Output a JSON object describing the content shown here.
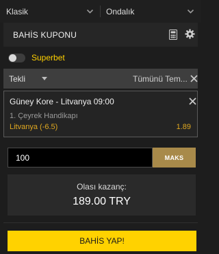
{
  "dropdowns": {
    "odds_format": "Klasik",
    "odds_display": "Ondalık"
  },
  "header": {
    "title": "BAHİS KUPONU",
    "icons": [
      "calculator-icon",
      "gear-icon"
    ]
  },
  "superbet": {
    "label": "Superbet",
    "enabled": false
  },
  "bet_type": {
    "selected": "Tekli",
    "remove_all": "Tümünü Tem..."
  },
  "bet": {
    "match": "Güney Kore - Litvanya 09:00",
    "market": "1. Çeyrek Handikapı",
    "selection": "Litvanya (-6.5)",
    "odds": "1.89"
  },
  "stake": {
    "value": "100",
    "max_label": "MAKS"
  },
  "winnings": {
    "label": "Olası kazanç:",
    "amount": "189.00 TRY"
  },
  "place_bet_label": "BAHİS YAP!",
  "colors": {
    "accent": "#ffd200",
    "odds": "#e0a820",
    "max_button": "#a88a4a"
  }
}
